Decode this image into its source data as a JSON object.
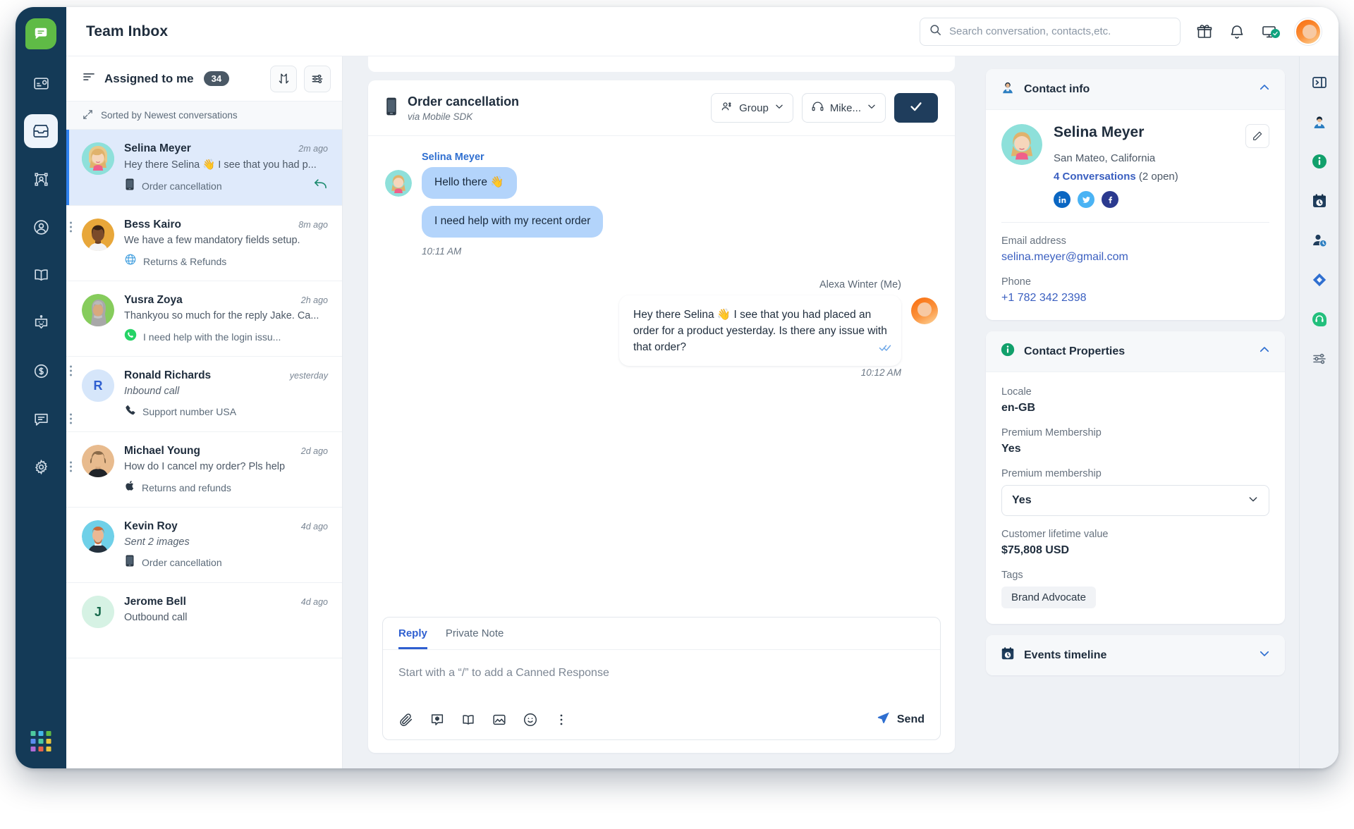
{
  "app": {
    "title": "Team Inbox",
    "logo_icon": "chat-logo-icon"
  },
  "search": {
    "placeholder": "Search conversation, contacts,etc.",
    "value": "",
    "icon": "search-icon"
  },
  "topbar": {
    "gift_icon": "gift-icon",
    "bell_icon": "bell-icon",
    "monitor_icon": "monitor-check-icon",
    "avatar": "user-avatar"
  },
  "rail": {
    "items": [
      {
        "icon": "dashboard-icon",
        "name": "sidebar-item-dashboard",
        "active": false,
        "dots": false
      },
      {
        "icon": "inbox-icon",
        "name": "sidebar-item-inbox",
        "active": true,
        "dots": false
      },
      {
        "icon": "flows-icon",
        "name": "sidebar-item-flows",
        "active": false,
        "dots": false
      },
      {
        "icon": "contacts-icon",
        "name": "sidebar-item-contacts",
        "active": false,
        "dots": true
      },
      {
        "icon": "knowledge-book-icon",
        "name": "sidebar-item-knowledge",
        "active": false,
        "dots": false
      },
      {
        "icon": "bot-icon",
        "name": "sidebar-item-bots",
        "active": false,
        "dots": false
      },
      {
        "icon": "billing-dollar-icon",
        "name": "sidebar-item-billing",
        "active": false,
        "dots": true
      },
      {
        "icon": "messages-icon",
        "name": "sidebar-item-messages",
        "active": false,
        "dots": true
      },
      {
        "icon": "settings-gear-icon",
        "name": "sidebar-item-settings",
        "active": false,
        "dots": true
      }
    ],
    "apps_grid_icon": "apps-grid-icon"
  },
  "conversation_list": {
    "header": {
      "menu_icon": "list-lines-icon",
      "title": "Assigned to me",
      "count": "34",
      "sort_icon": "sort-arrows-icon",
      "filter_icon": "filter-sliders-icon"
    },
    "sort_bar": {
      "icon": "sort-direction-icon",
      "label": "Sorted by Newest conversations"
    },
    "items": [
      {
        "name": "Selina Meyer",
        "time": "2m ago",
        "snippet": "Hey there Selina 👋 I see that you had p...",
        "snippet_italic": false,
        "channel": "Order cancellation",
        "channel_icon": "mobile-sdk-icon",
        "selected": true,
        "reply_icon": "reply-arrow-icon",
        "avatar_type": "photo-blonde"
      },
      {
        "name": "Bess Kairo",
        "time": "8m ago",
        "snippet": "We have a few mandatory fields setup.",
        "snippet_italic": false,
        "channel": "Returns & Refunds",
        "channel_icon": "website-globe-icon",
        "selected": false,
        "reply_icon": null,
        "avatar_type": "photo-orange"
      },
      {
        "name": "Yusra Zoya",
        "time": "2h ago",
        "snippet": "Thankyou so much for the reply Jake. Ca...",
        "snippet_italic": false,
        "channel": "I need help with the login issu...",
        "channel_icon": "whatsapp-icon",
        "selected": false,
        "reply_icon": null,
        "avatar_type": "photo-green"
      },
      {
        "name": "Ronald Richards",
        "time": "yesterday",
        "snippet": "Inbound call",
        "snippet_italic": true,
        "channel": "Support number USA",
        "channel_icon": "phone-icon",
        "selected": false,
        "reply_icon": null,
        "avatar_type": "initial-R"
      },
      {
        "name": "Michael Young",
        "time": "2d ago",
        "snippet": "How do I cancel my order? Pls help",
        "snippet_italic": false,
        "channel": "Returns and refunds",
        "channel_icon": "apple-icon",
        "selected": false,
        "reply_icon": null,
        "avatar_type": "photo-tan"
      },
      {
        "name": "Kevin Roy",
        "time": "4d ago",
        "snippet": "Sent 2 images",
        "snippet_italic": true,
        "channel": "Order cancellation",
        "channel_icon": "mobile-sdk-icon",
        "selected": false,
        "reply_icon": null,
        "avatar_type": "photo-cyan"
      },
      {
        "name": "Jerome Bell",
        "time": "4d ago",
        "snippet": "Outbound call",
        "snippet_italic": false,
        "channel": "",
        "channel_icon": null,
        "selected": false,
        "reply_icon": null,
        "avatar_type": "initial-J"
      }
    ]
  },
  "thread": {
    "header": {
      "icon": "mobile-sdk-icon",
      "title": "Order cancellation",
      "subtitle": "via Mobile SDK",
      "group_label": "Group",
      "group_icon": "group-people-icon",
      "agent_label": "Mike...",
      "agent_icon": "headset-icon",
      "chevron_icon": "chevron-down-icon",
      "resolve_icon": "check-icon"
    },
    "messages": [
      {
        "direction": "in",
        "sender": "Selina Meyer",
        "bubbles": [
          "Hello there 👋",
          "I need help with my recent order"
        ],
        "time": "10:11 AM"
      },
      {
        "direction": "out",
        "sender": "Alexa Winter (Me)",
        "bubbles": [
          "Hey there Selina 👋 I see that you had placed an order for a product yesterday. Is there any issue with that order?"
        ],
        "time": "10:12 AM",
        "status_icon": "double-check-icon"
      }
    ],
    "composer": {
      "tabs": [
        {
          "label": "Reply",
          "active": true
        },
        {
          "label": "Private Note",
          "active": false
        }
      ],
      "placeholder": "Start with a “/” to add a Canned Response",
      "value": "",
      "tools": [
        {
          "icon": "paperclip-icon",
          "name": "attach-file-button"
        },
        {
          "icon": "canned-response-icon",
          "name": "canned-response-button"
        },
        {
          "icon": "knowledge-book-icon",
          "name": "knowledge-base-button"
        },
        {
          "icon": "image-icon",
          "name": "insert-image-button"
        },
        {
          "icon": "emoji-icon",
          "name": "emoji-picker-button"
        },
        {
          "icon": "more-vertical-icon",
          "name": "more-options-button"
        }
      ],
      "send_label": "Send",
      "send_icon": "send-plane-icon"
    }
  },
  "right_panel": {
    "contact_info": {
      "icon": "contact-person-icon",
      "title": "Contact info",
      "chevron": "chevron-up-icon",
      "name": "Selina Meyer",
      "location": "San Mateo, California",
      "conversations_link": "4 Conversations",
      "conversations_note": "(2 open)",
      "edit_icon": "pencil-edit-icon",
      "socials": [
        {
          "name": "linkedin-icon",
          "label": "in",
          "color": "#0a66c2"
        },
        {
          "name": "twitter-icon",
          "label": "t",
          "color": "#4ab3f4"
        },
        {
          "name": "facebook-icon",
          "label": "f",
          "color": "#2b3a8f"
        }
      ],
      "email_label": "Email address",
      "email_value": "selina.meyer@gmail.com",
      "phone_label": "Phone",
      "phone_value": "+1 782 342 2398"
    },
    "contact_properties": {
      "icon": "info-circle-icon",
      "title": "Contact Properties",
      "chevron": "chevron-up-icon",
      "fields": [
        {
          "label": "Locale",
          "value": "en-GB",
          "type": "text"
        },
        {
          "label": "Premium Membership",
          "value": "Yes",
          "type": "text"
        },
        {
          "label": "Premium membership",
          "value": "Yes",
          "type": "select"
        },
        {
          "label": "Customer lifetime value",
          "value": "$75,808 USD",
          "type": "text"
        }
      ],
      "tags_label": "Tags",
      "tags": [
        "Brand Advocate"
      ]
    },
    "events_timeline": {
      "icon": "clock-calendar-icon",
      "title": "Events timeline",
      "chevron": "chevron-down-icon"
    }
  },
  "far_rail": {
    "items": [
      {
        "icon": "panel-collapse-icon",
        "name": "collapse-panel-button"
      },
      {
        "icon": "contact-person-icon",
        "name": "contact-info-tab"
      },
      {
        "icon": "info-circle-icon",
        "name": "contact-properties-tab"
      },
      {
        "icon": "clock-calendar-icon",
        "name": "events-timeline-tab"
      },
      {
        "icon": "user-clock-icon",
        "name": "previous-conversations-tab"
      },
      {
        "icon": "jira-diamond-icon",
        "name": "jira-integration-tab"
      },
      {
        "icon": "support-headset-icon",
        "name": "support-integration-tab"
      },
      {
        "icon": "sliders-icon",
        "name": "panel-settings-button"
      }
    ]
  },
  "colors": {
    "rail_bg": "#143a57",
    "accent_blue": "#2f80ed",
    "selected_row": "#dfeafb",
    "bubble_in": "#b3d4fb",
    "resolve_btn": "#1f3d5c",
    "logo_green": "#5fbb46",
    "link_blue": "#3a5fc0",
    "canvas": "#eef1f5"
  }
}
